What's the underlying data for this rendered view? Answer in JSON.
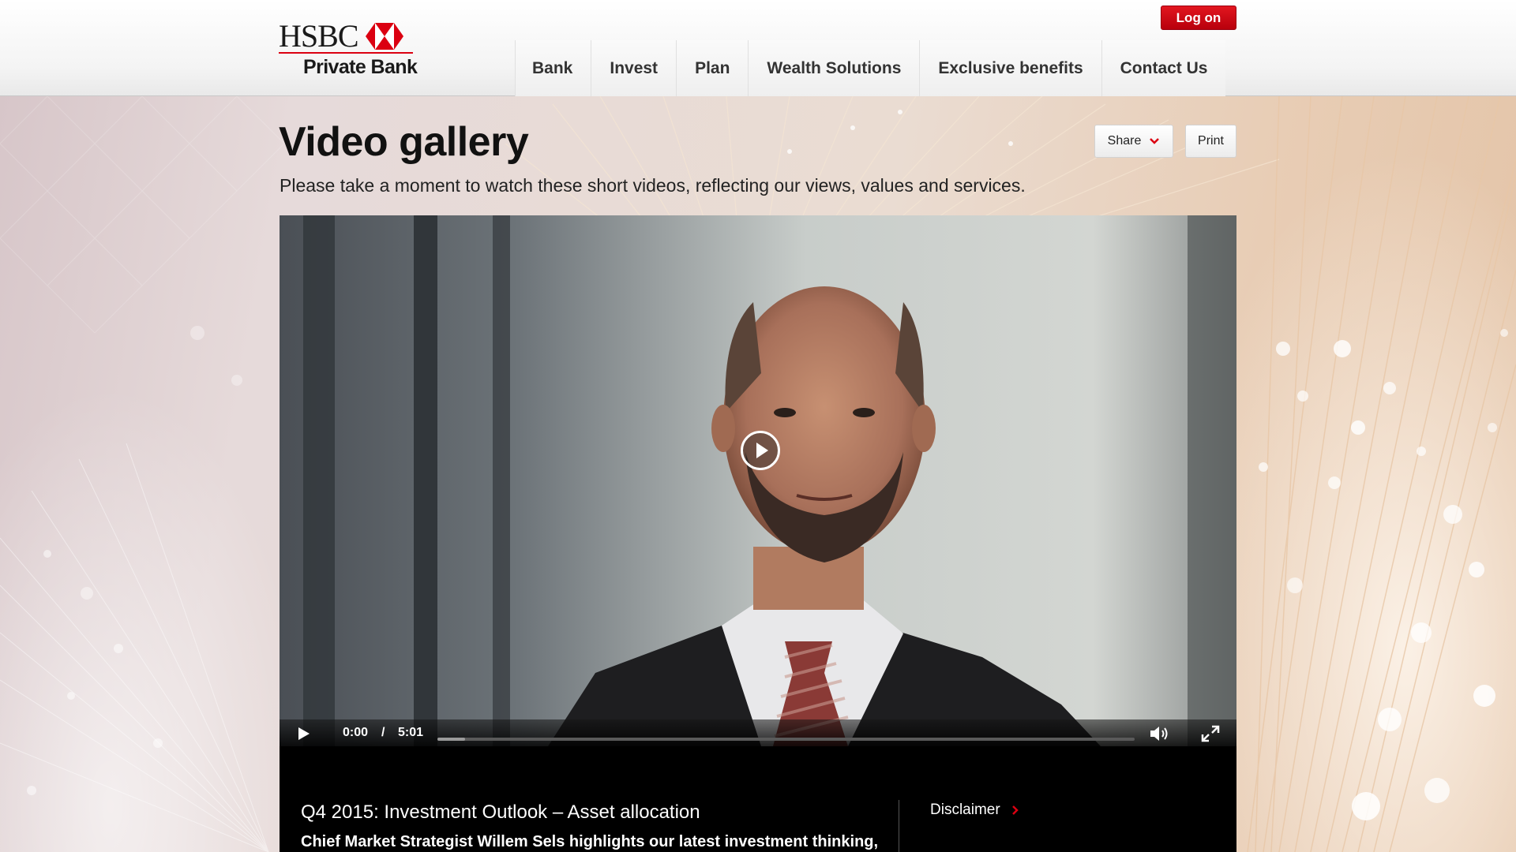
{
  "brand": {
    "name": "HSBC",
    "division": "Private Bank",
    "accent": "#db0011"
  },
  "header": {
    "logon_label": "Log on",
    "nav": [
      "Bank",
      "Invest",
      "Plan",
      "Wealth Solutions",
      "Exclusive benefits",
      "Contact Us"
    ]
  },
  "page": {
    "title": "Video gallery",
    "subtitle": "Please take a moment to watch these short videos, reflecting our views, values and services.",
    "share_label": "Share",
    "print_label": "Print"
  },
  "video": {
    "current_time": "0:00",
    "separator": "/",
    "duration": "5:01",
    "buffered_fraction": 0.04,
    "play_icon": "play-icon",
    "volume_icon": "volume-icon",
    "fullscreen_icon": "fullscreen-icon"
  },
  "video_info": {
    "title": "Q4 2015: Investment Outlook – Asset allocation",
    "description": "Chief Market Strategist Willem Sels highlights our latest investment thinking,",
    "disclaimer_label": "Disclaimer"
  }
}
